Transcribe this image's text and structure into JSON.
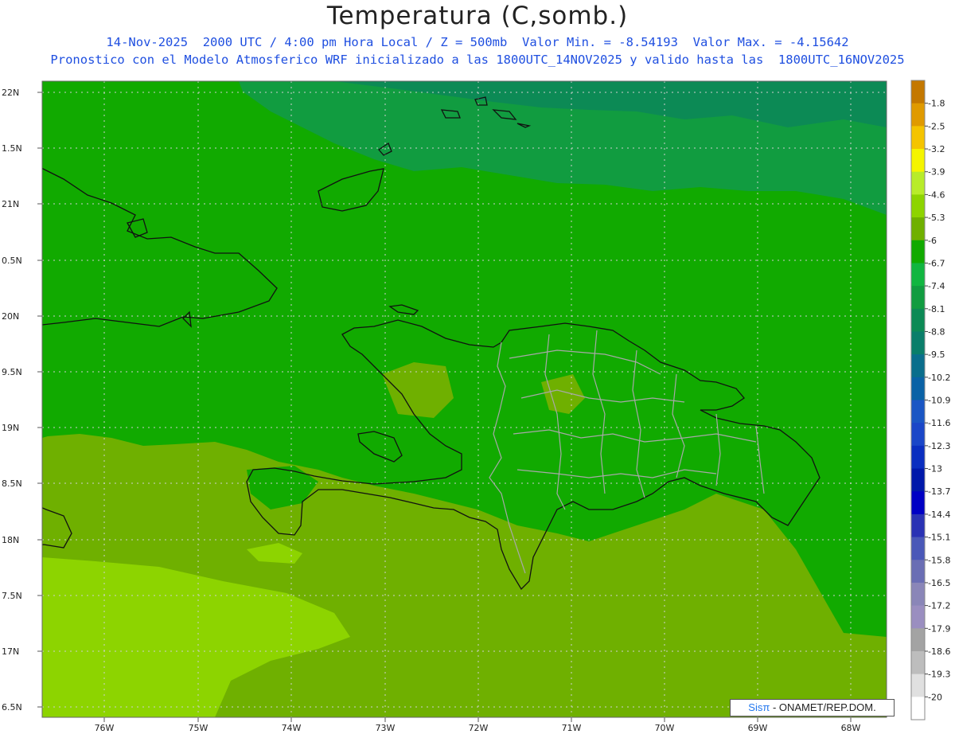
{
  "header": {
    "title": "Temperatura (C,somb.)",
    "line1": "14-Nov-2025  2000 UTC / 4:00 pm Hora Local / Z = 500mb  Valor Min. = -8.54193  Valor Max. = -4.15642",
    "line2": "Pronostico con el Modelo Atmosferico WRF inicializado a las 1800UTC_14NOV2025 y valido hasta las  1800UTC_16NOV2025"
  },
  "axes": {
    "lat_labels": [
      "22N",
      "1.5N",
      "21N",
      "0.5N",
      "20N",
      "9.5N",
      "19N",
      "8.5N",
      "18N",
      "7.5N",
      "17N",
      "6.5N"
    ],
    "lon_labels": [
      "76W",
      "75W",
      "74W",
      "73W",
      "72W",
      "71W",
      "70W",
      "69W",
      "68W"
    ]
  },
  "colorbar": {
    "labels": [
      "-1.8",
      "-2.5",
      "-3.2",
      "-3.9",
      "-4.6",
      "-5.3",
      "-6",
      "-6.7",
      "-7.4",
      "-8.1",
      "-8.8",
      "-9.5",
      "-10.2",
      "-10.9",
      "-11.6",
      "-12.3",
      "-13",
      "-13.7",
      "-14.4",
      "-15.1",
      "-15.8",
      "-16.5",
      "-17.2",
      "-17.9",
      "-18.6",
      "-19.3",
      "-20"
    ],
    "colors": [
      "#c47800",
      "#e09a00",
      "#f5c400",
      "#f5f500",
      "#b8ec2a",
      "#8dd400",
      "#6fb000",
      "#11aa00",
      "#11b640",
      "#119c40",
      "#0c8a55",
      "#0a7e6a",
      "#0a6e8c",
      "#0a62a6",
      "#1a56c4",
      "#1a46c8",
      "#0a2ec0",
      "#0018aa",
      "#0000c4",
      "#2a32b4",
      "#4a58b8",
      "#6a6eb4",
      "#8a86b8",
      "#9a8ec0",
      "#a3a3a3",
      "#bdbdbd",
      "#e0e0e0",
      "#ffffff"
    ]
  },
  "map_colors": {
    "band_south": "#8dd400",
    "band_mid": "#6fb000",
    "band_main": "#11aa00",
    "band_north": "#119c40",
    "band_far_north": "#0c8a55",
    "coast": "#111111",
    "provinces": "#a8a8a8"
  },
  "credit": {
    "brand": "Sisπ",
    "text": "- ONAMET/REP.DOM."
  }
}
